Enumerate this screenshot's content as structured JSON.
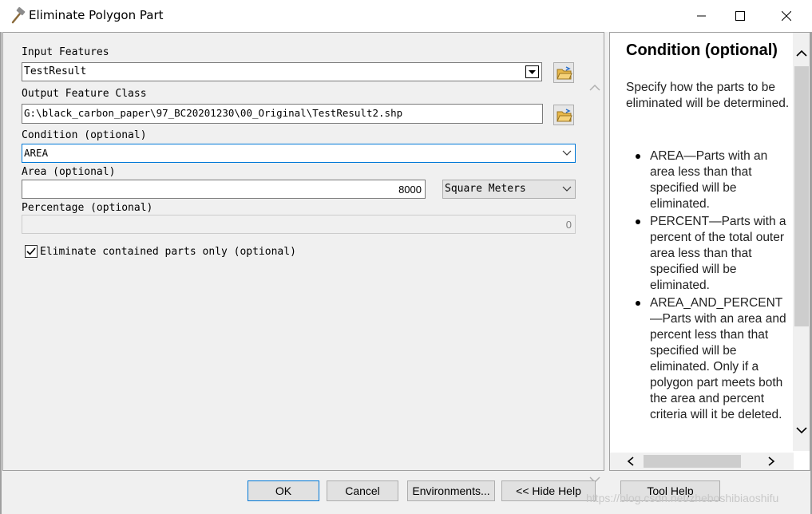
{
  "window": {
    "title": "Eliminate Polygon Part",
    "icon": "hammer-icon",
    "controls": [
      "minimize-icon",
      "maximize-icon",
      "close-icon"
    ]
  },
  "form": {
    "input_features": {
      "label": "Input Features",
      "value": "TestResult"
    },
    "output_feature_class": {
      "label": "Output Feature Class",
      "value": "G:\\black_carbon_paper\\97_BC20201230\\00_Original\\TestResult2.shp"
    },
    "condition": {
      "label": "Condition (optional)",
      "value": "AREA"
    },
    "area": {
      "label": "Area (optional)",
      "value": "8000",
      "unit": "Square Meters"
    },
    "percentage": {
      "label": "Percentage (optional)",
      "value": "0"
    },
    "eliminate_contained": {
      "label": "Eliminate contained parts only (optional)",
      "checked": true
    }
  },
  "help": {
    "title": "Condition (optional)",
    "intro": "Specify how the parts to be eliminated will be determined.",
    "items": [
      "AREA—Parts with an area less than that specified will be eliminated.",
      "PERCENT—Parts with a percent of the total outer area less than that specified will be eliminated.",
      "AREA_AND_PERCENT—Parts with an area and percent less than that specified will be eliminated. Only if a polygon part meets both the area and percent criteria will it be deleted."
    ]
  },
  "buttons": {
    "ok": "OK",
    "cancel": "Cancel",
    "environments": "Environments...",
    "hide_help": "<< Hide Help",
    "tool_help": "Tool Help"
  },
  "watermark": "https://blog.csdn.net/zheboshibiaoshifu",
  "colors": {
    "focus_border": "#0078d7",
    "folder": "#e8b84a",
    "disabled_bg": "#f0f0f0"
  }
}
